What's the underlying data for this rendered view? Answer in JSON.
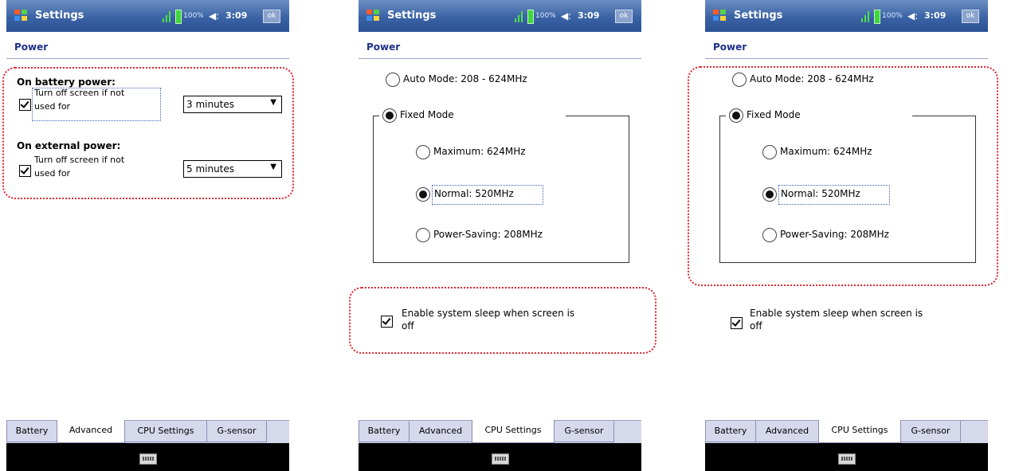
{
  "screens": [
    {
      "titlebar": {
        "title": "Settings",
        "battery": "100%",
        "time": "3:09",
        "ok": "ok"
      },
      "header": "Power",
      "battery_section": {
        "heading": "On battery power:",
        "checkbox_label_1": "Turn off screen if not",
        "checkbox_label_2": "used for",
        "select_value": "3 minutes",
        "checked": true
      },
      "external_section": {
        "heading": "On external power:",
        "checkbox_label_1": "Turn off screen if not",
        "checkbox_label_2": "used for",
        "select_value": "5 minutes",
        "checked": true
      },
      "tabs": [
        "Battery",
        "Advanced",
        "CPU Settings",
        "G-sensor"
      ],
      "active_tab": "Advanced"
    },
    {
      "titlebar": {
        "title": "Settings",
        "battery": "100%",
        "time": "3:09",
        "ok": "ok"
      },
      "header": "Power",
      "auto_mode": "Auto Mode: 208 - 624MHz",
      "fixed_mode": "Fixed Mode",
      "maximum": "Maximum: 624MHz",
      "normal": "Normal: 520MHz",
      "power_saving": "Power-Saving: 208MHz",
      "sleep_label_1": "Enable system sleep when screen is",
      "sleep_label_2": "off",
      "tabs": [
        "Battery",
        "Advanced",
        "CPU Settings",
        "G-sensor"
      ],
      "active_tab": "CPU Settings"
    },
    {
      "titlebar": {
        "title": "Settings",
        "battery": "100%",
        "time": "3:09",
        "ok": "ok"
      },
      "header": "Power",
      "auto_mode": "Auto Mode: 208 - 624MHz",
      "fixed_mode": "Fixed Mode",
      "maximum": "Maximum: 624MHz",
      "normal": "Normal: 520MHz",
      "power_saving": "Power-Saving: 208MHz",
      "sleep_label_1": "Enable system sleep when screen is",
      "sleep_label_2": "off",
      "tabs": [
        "Battery",
        "Advanced",
        "CPU Settings",
        "G-sensor"
      ],
      "active_tab": "CPU Settings"
    }
  ],
  "colors": {
    "highlight": "#e0262f",
    "titlebar": "#3a63a5",
    "header_text": "#1d2f8a"
  }
}
